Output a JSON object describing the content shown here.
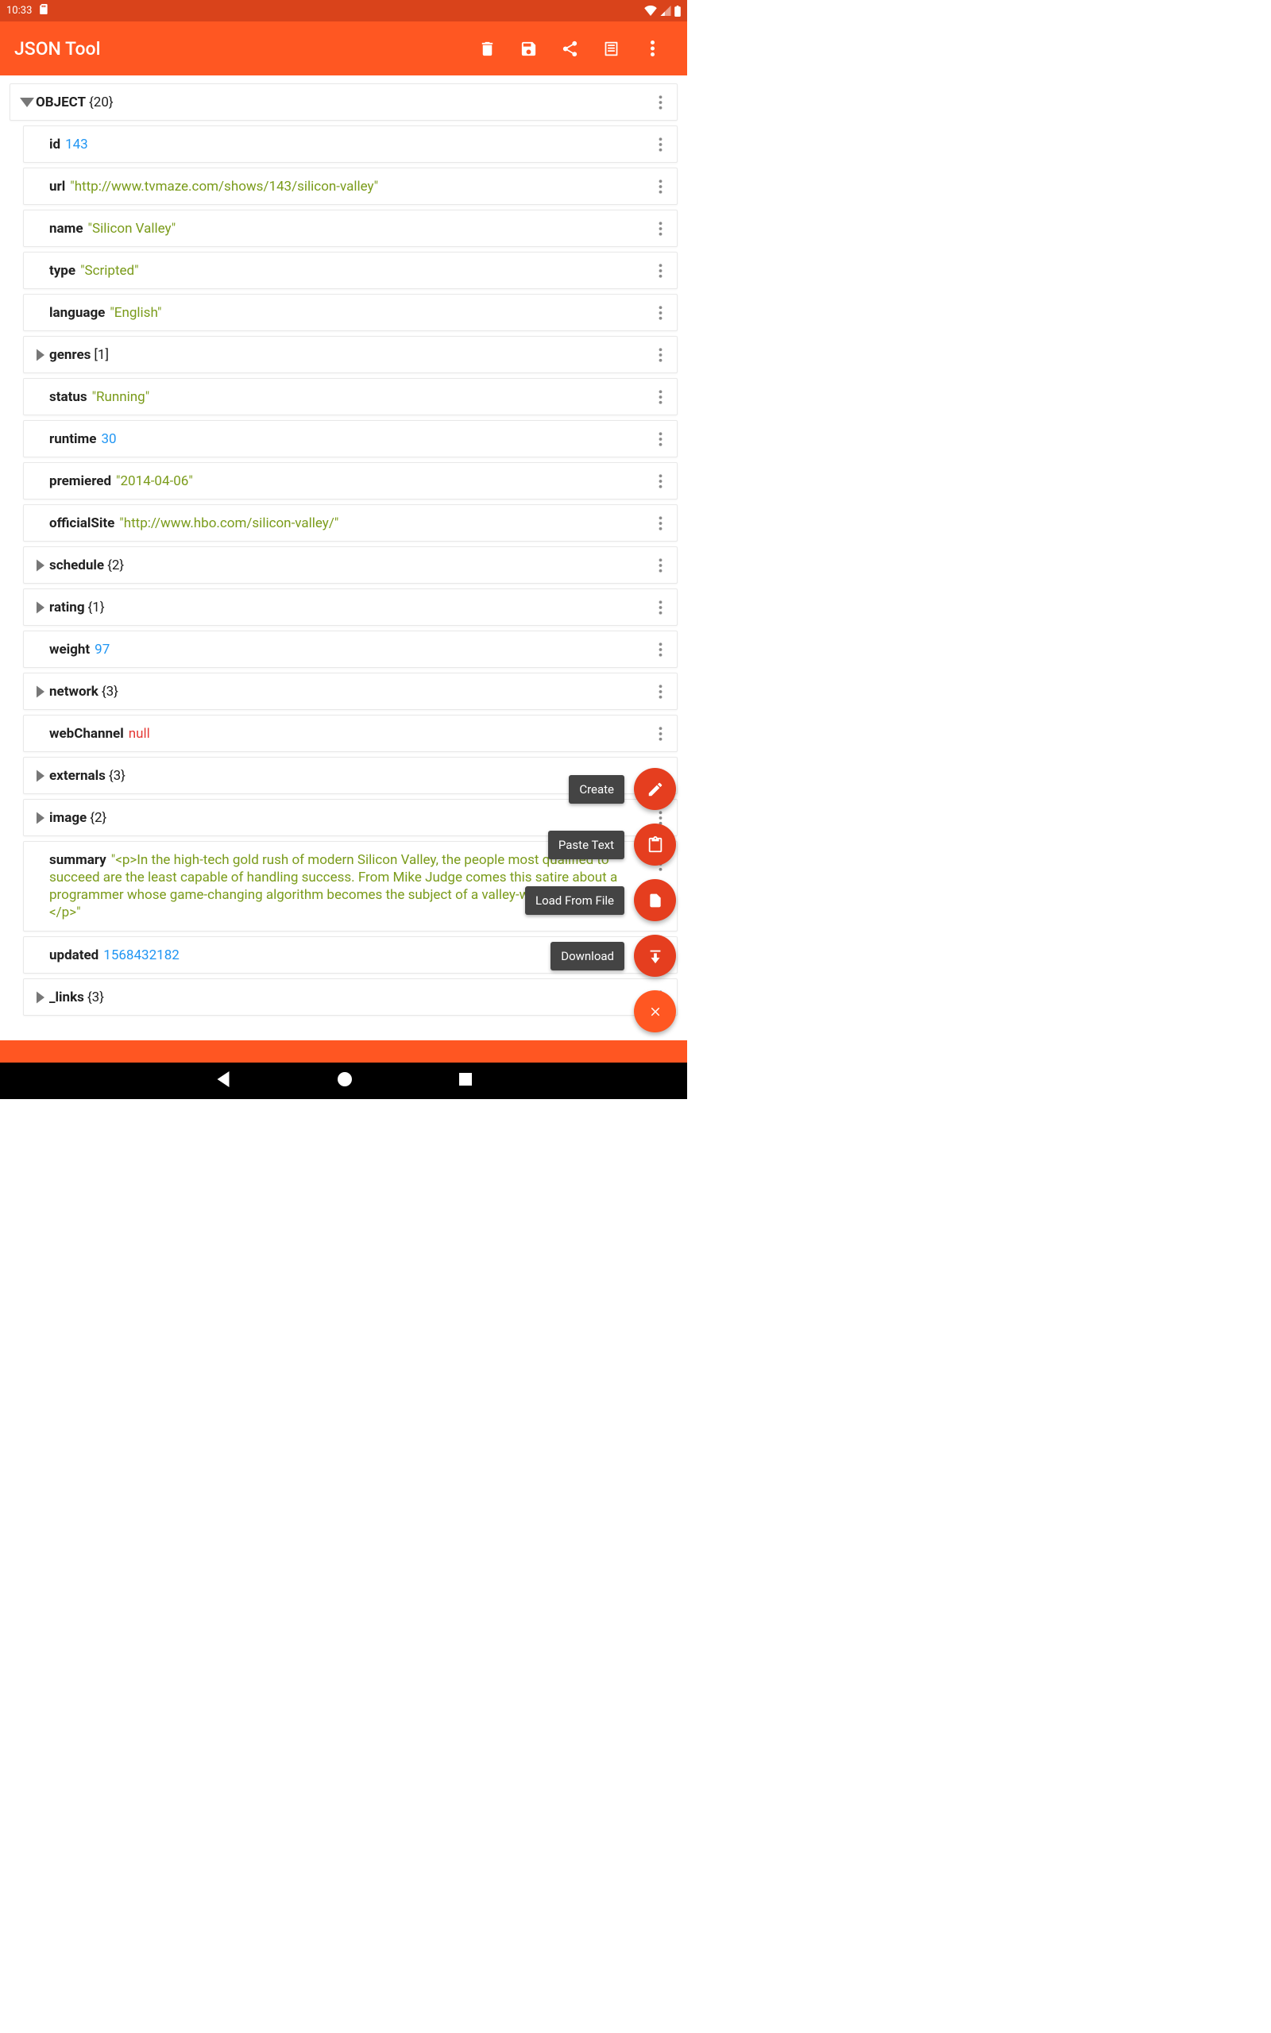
{
  "statusbar": {
    "time": "10:33"
  },
  "appbar": {
    "title": "JSON Tool"
  },
  "root": {
    "label": "OBJECT",
    "count": "{20}"
  },
  "rows": [
    {
      "key": "id",
      "val": "143",
      "type": "num",
      "expand": false,
      "indent": true
    },
    {
      "key": "url",
      "val": "\"http://www.tvmaze.com/shows/143/silicon-valley\"",
      "type": "str",
      "expand": false,
      "indent": true
    },
    {
      "key": "name",
      "val": "\"Silicon Valley\"",
      "type": "str",
      "expand": false,
      "indent": true
    },
    {
      "key": "type",
      "val": "\"Scripted\"",
      "type": "str",
      "expand": false,
      "indent": true
    },
    {
      "key": "language",
      "val": "\"English\"",
      "type": "str",
      "expand": false,
      "indent": true
    },
    {
      "key": "genres",
      "count": "[1]",
      "expand": true,
      "indent": false
    },
    {
      "key": "status",
      "val": "\"Running\"",
      "type": "str",
      "expand": false,
      "indent": true
    },
    {
      "key": "runtime",
      "val": "30",
      "type": "num",
      "expand": false,
      "indent": true
    },
    {
      "key": "premiered",
      "val": "\"2014-04-06\"",
      "type": "str",
      "expand": false,
      "indent": true
    },
    {
      "key": "officialSite",
      "val": "\"http://www.hbo.com/silicon-valley/\"",
      "type": "str",
      "expand": false,
      "indent": true
    },
    {
      "key": "schedule",
      "count": "{2}",
      "expand": true,
      "indent": false
    },
    {
      "key": "rating",
      "count": "{1}",
      "expand": true,
      "indent": false
    },
    {
      "key": "weight",
      "val": "97",
      "type": "num",
      "expand": false,
      "indent": true
    },
    {
      "key": "network",
      "count": "{3}",
      "expand": true,
      "indent": false
    },
    {
      "key": "webChannel",
      "val": "null",
      "type": "null",
      "expand": false,
      "indent": true
    },
    {
      "key": "externals",
      "count": "{3}",
      "expand": true,
      "indent": false
    },
    {
      "key": "image",
      "count": "{2}",
      "expand": true,
      "indent": false
    }
  ],
  "summaryKey": "summary",
  "summaryVal": "\"<p>In the high-tech gold rush of modern Silicon Valley, the people most qualified to succeed are the least capable of handling success. From Mike Judge comes this satire about a programmer whose game-changing algorithm becomes the subject of a valley-wide bidding war.</p>\"",
  "updated": {
    "key": "updated",
    "val": "1568432182"
  },
  "links": {
    "key": "_links",
    "count": "{3}"
  },
  "fabs": {
    "create": "Create",
    "paste": "Paste Text",
    "load": "Load From File",
    "download": "Download"
  }
}
